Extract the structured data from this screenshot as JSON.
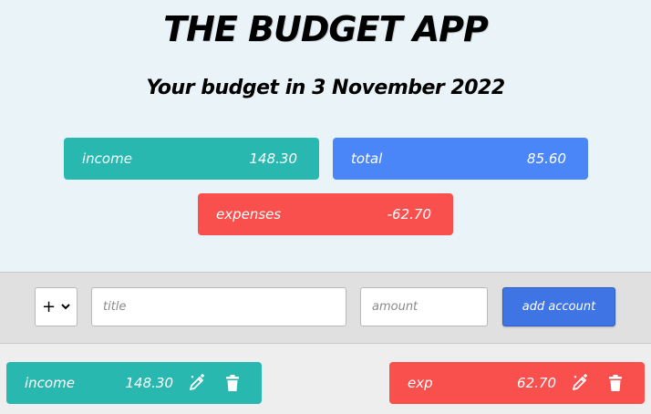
{
  "header": {
    "title": "THE BUDGET APP",
    "subtitle": "Your budget in 3 November 2022"
  },
  "summary": {
    "income": {
      "label": "income",
      "value": "148.30",
      "color": "#28b8b0"
    },
    "total": {
      "label": "total",
      "value": "85.60",
      "color": "#4a86f7"
    },
    "expenses": {
      "label": "expenses",
      "value": "-62.70",
      "color": "#f9504d"
    }
  },
  "form": {
    "sign_value": "+",
    "title_placeholder": "title",
    "amount_placeholder": "amount",
    "add_label": "add account"
  },
  "entries": [
    {
      "name": "income",
      "amount": "148.30",
      "type": "income",
      "icons": [
        "edit-icon",
        "trash-icon"
      ]
    },
    {
      "name": "exp",
      "amount": "62.70",
      "type": "expense",
      "icons": [
        "edit-icon",
        "trash-icon"
      ]
    }
  ]
}
